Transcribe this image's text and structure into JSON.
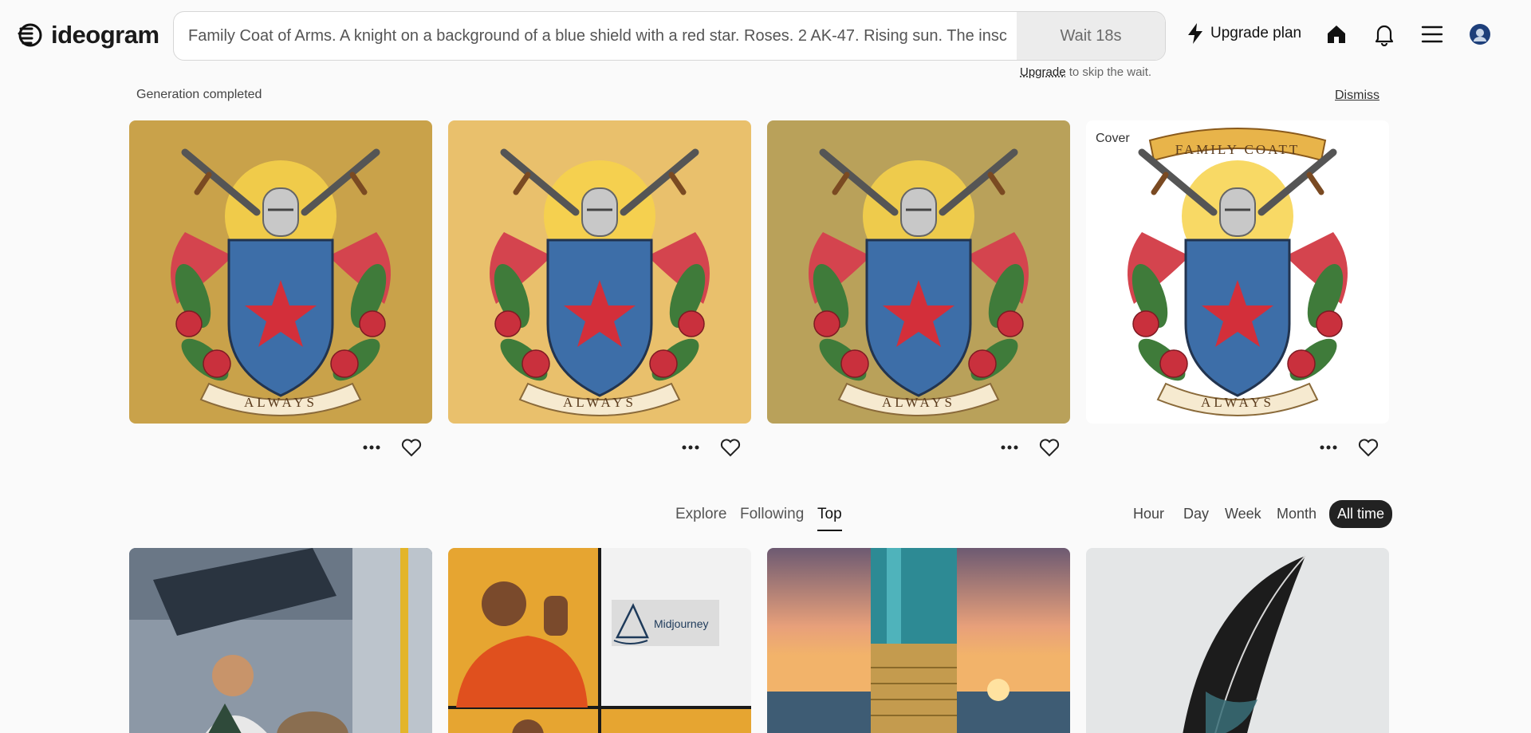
{
  "app": {
    "name": "ideogram"
  },
  "prompt": {
    "value": "Family Coat of Arms. A knight on a background of a blue shield with a red star. Roses. 2 AK-47. Rising sun. The insc",
    "wait_label": "Wait 18s"
  },
  "upgrade_note": {
    "link": "Upgrade",
    "rest": " to skip the wait."
  },
  "header": {
    "upgrade_plan": "Upgrade plan",
    "icons": [
      "lightning-icon",
      "home-icon",
      "bell-icon",
      "menu-icon",
      "avatar"
    ]
  },
  "generation": {
    "status": "Generation completed",
    "dismiss": "Dismiss",
    "cards": [
      {
        "motto": "ALWAYS",
        "bg": "#c9a24a"
      },
      {
        "motto": "ALWAYS",
        "bg": "#e9c06c"
      },
      {
        "motto": "ALWAYS",
        "bg": "#b9a15a"
      },
      {
        "motto": "ALWAYS",
        "banner": "FAMILY COATT",
        "cover": "Cover",
        "bg": "#ffffff"
      }
    ]
  },
  "feed": {
    "tabs": [
      "Explore",
      "Following",
      "Top"
    ],
    "active_tab": "Top",
    "time_filters": [
      "Hour",
      "Day",
      "Week",
      "Month",
      "All time"
    ],
    "active_filter": "All time",
    "cards": [
      {
        "label": ""
      },
      {
        "label": "Midjourney"
      },
      {
        "label": ""
      },
      {
        "label": ""
      }
    ]
  },
  "colors": {
    "accent": "#111111",
    "shield_blue": "#3d6ea8",
    "star_red": "#d32f3a",
    "rose_red": "#c9303d",
    "leaf_green": "#3f7b3a"
  }
}
